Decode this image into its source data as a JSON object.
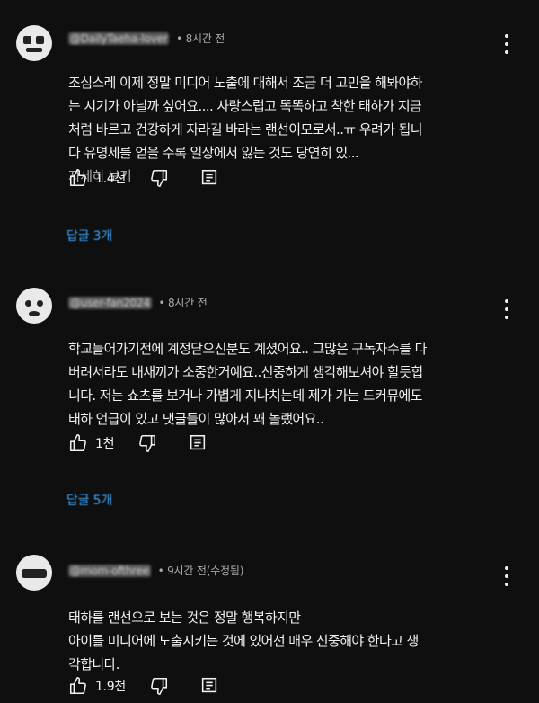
{
  "comments": [
    {
      "handle": "@DailyTaeha-lover",
      "time": "8시간 전",
      "text": "조심스레 이제 정말 미디어 노출에 대해서 조금 더 고민을 해봐야하\n는 시기가 아닐까 싶어요.... 사랑스럽고 똑똑하고 착한 태하가 지금\n처럼 바르고 건강하게 자라길 바라는 랜선이모로서..ㅠ 우려가 됩니\n다 유명세를 얻을 수록 일상에서 잃는 것도 당연히 있...",
      "more_label": "자세히 보기",
      "likes": "1.4천",
      "replies": "답글 3개"
    },
    {
      "handle": "@user-fan2024",
      "time": "8시간 전",
      "text": "학교들어가기전에 계정닫으신분도 계셨어요.. 그많은 구독자수를 다\n버려서라도 내새끼가 소중한거예요..신중하게 생각해보셔야 할듯힙\n니다. 저는 쇼츠를 보거나 가볍게 지나치는데 제가 가는 드커뮤에도\n태하 언급이 있고 댓글들이 많아서 꽤 놀랬어요..",
      "more_label": "",
      "likes": "1천",
      "replies": "답글 5개"
    },
    {
      "handle": "@mom-ofthree",
      "time": "9시간 전(수정됨)",
      "text": "태하를 랜선으로 보는 것은 정말 행복하지만\n아이를 미디어에 노출시키는 것에 있어선 매우 신중해야 한다고 생\n각합니다.",
      "more_label": "",
      "likes": "1.9천",
      "replies": ""
    }
  ]
}
